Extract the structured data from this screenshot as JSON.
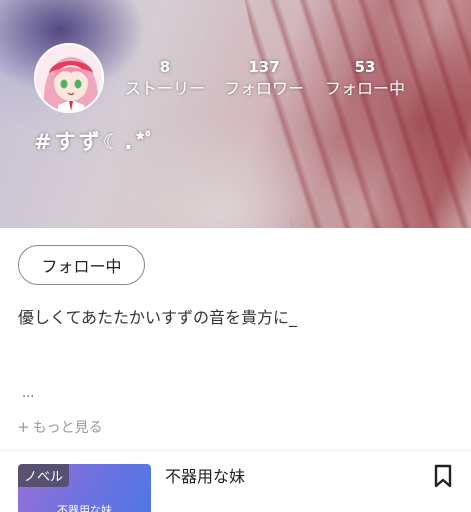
{
  "profile": {
    "username": "#すず☾.*ﾟ",
    "bio": "優しくてあたたかいすずの音を貴方に_",
    "bio_ellipsis": "...",
    "more_label": "もっと見る",
    "more_plus": "+"
  },
  "stats": [
    {
      "value": "8",
      "label": "ストーリー"
    },
    {
      "value": "137",
      "label": "フォロワー"
    },
    {
      "value": "53",
      "label": "フォロー中"
    }
  ],
  "follow_button": {
    "label": "フォロー中"
  },
  "stories": [
    {
      "badge": "ノベル",
      "thumb_title": "不器用な妹",
      "title": "不器用な妹"
    }
  ],
  "icons": {
    "bookmark": "bookmark-icon",
    "avatar": "avatar-illustration"
  },
  "colors": {
    "button_border": "#888888",
    "thumb_gradient_start": "#9b6fd6",
    "thumb_gradient_end": "#4b79e6"
  }
}
